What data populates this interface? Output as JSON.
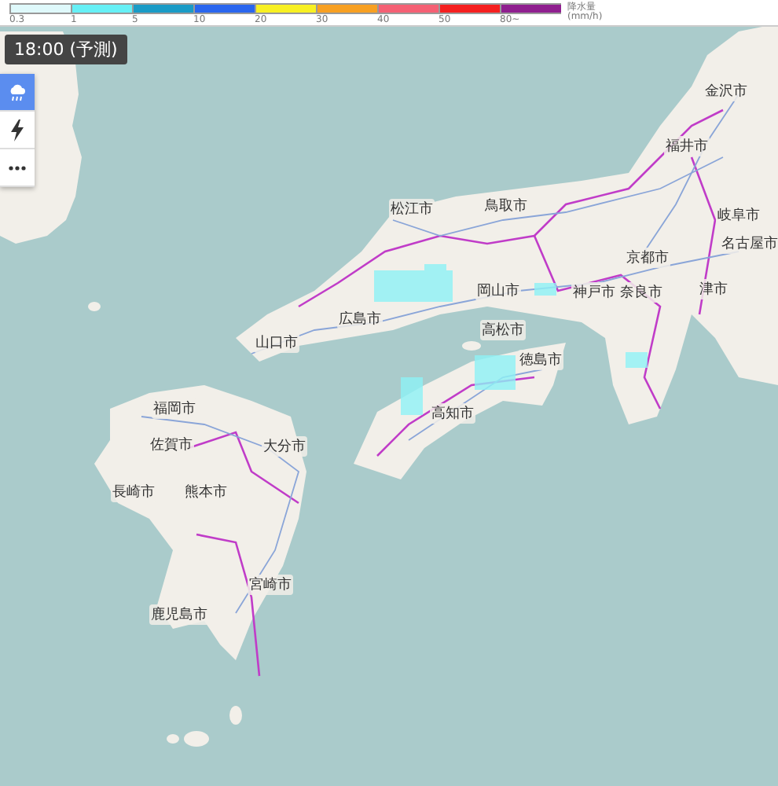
{
  "legend": {
    "title": "降水量",
    "unit": "(mm/h)",
    "bins": [
      {
        "label": "0.3",
        "color": "#dff9fb"
      },
      {
        "label": "1",
        "color": "#66f0f6"
      },
      {
        "label": "5",
        "color": "#1a9bc6"
      },
      {
        "label": "10",
        "color": "#2a66ee"
      },
      {
        "label": "20",
        "color": "#f8f022"
      },
      {
        "label": "30",
        "color": "#f8a022"
      },
      {
        "label": "40",
        "color": "#f56074"
      },
      {
        "label": "50",
        "color": "#f51f1f"
      },
      {
        "label": "80~",
        "color": "#8f1f8f"
      }
    ]
  },
  "time_label": "18:00 (予測)",
  "layers": [
    {
      "kind": "rain",
      "selected": true
    },
    {
      "kind": "lightning",
      "selected": false
    },
    {
      "kind": "more",
      "selected": false
    }
  ],
  "cities": [
    "金沢市",
    "福井市",
    "岐阜市",
    "松江市",
    "鳥取市",
    "京都市",
    "名古屋市",
    "岡山市",
    "神戸市",
    "奈良市",
    "津市",
    "広島市",
    "山口市",
    "高松市",
    "徳島市",
    "高知市",
    "福岡市",
    "佐賀市",
    "大分市",
    "長崎市",
    "熊本市",
    "宮崎市",
    "鹿児島市"
  ]
}
